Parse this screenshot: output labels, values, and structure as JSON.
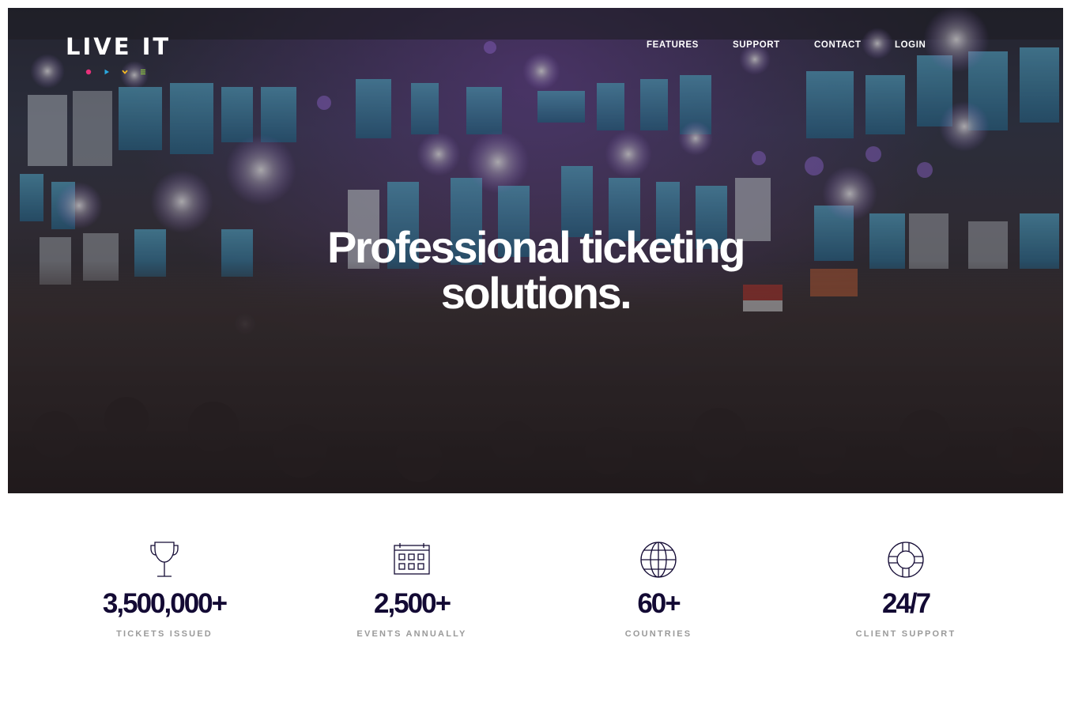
{
  "colors": {
    "dot_pink": "#e8317a",
    "dot_blue": "#2aa9e0",
    "dot_yellow": "#f2b823",
    "dot_green": "#8cc63f",
    "stat_value": "#130a34",
    "stat_label": "#9a9a9a"
  },
  "brand": {
    "logo": "LIVE IT"
  },
  "nav": {
    "features": "FEATURES",
    "support": "SUPPORT",
    "contact": "CONTACT",
    "login": "LOGIN"
  },
  "hero": {
    "headline_line1": "Professional ticketing",
    "headline_line2": "solutions."
  },
  "stats": [
    {
      "icon": "trophy-icon",
      "value": "3,500,000+",
      "label": "TICKETS ISSUED"
    },
    {
      "icon": "calendar-icon",
      "value": "2,500+",
      "label": "EVENTS ANNUALLY"
    },
    {
      "icon": "globe-icon",
      "value": "60+",
      "label": "COUNTRIES"
    },
    {
      "icon": "lifebuoy-icon",
      "value": "24/7",
      "label": "CLIENT SUPPORT"
    }
  ]
}
